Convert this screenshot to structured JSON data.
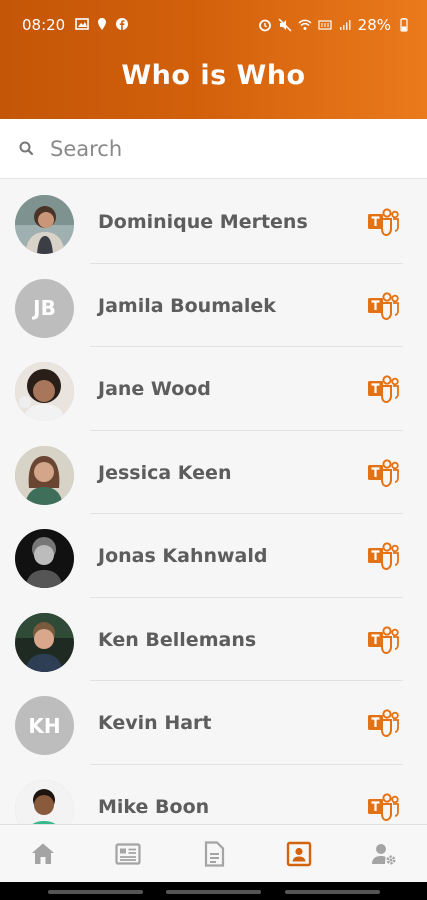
{
  "status_bar": {
    "time": "08:20",
    "battery": "28%"
  },
  "header": {
    "title": "Who is Who"
  },
  "search": {
    "placeholder": "Search"
  },
  "accent": "#e37214",
  "people": [
    {
      "name": "Dominique Mertens",
      "initials": "",
      "photo": true
    },
    {
      "name": "Jamila Boumalek",
      "initials": "JB",
      "photo": false
    },
    {
      "name": "Jane Wood",
      "initials": "",
      "photo": true
    },
    {
      "name": "Jessica Keen",
      "initials": "",
      "photo": true
    },
    {
      "name": "Jonas Kahnwald",
      "initials": "",
      "photo": true
    },
    {
      "name": "Ken Bellemans",
      "initials": "",
      "photo": true
    },
    {
      "name": "Kevin Hart",
      "initials": "KH",
      "photo": false
    },
    {
      "name": "Mike Boon",
      "initials": "",
      "photo": true
    }
  ],
  "bottom_nav": [
    {
      "icon": "home-icon",
      "active": false
    },
    {
      "icon": "news-icon",
      "active": false
    },
    {
      "icon": "document-icon",
      "active": false
    },
    {
      "icon": "contacts-icon",
      "active": true
    },
    {
      "icon": "user-settings-icon",
      "active": false
    }
  ]
}
